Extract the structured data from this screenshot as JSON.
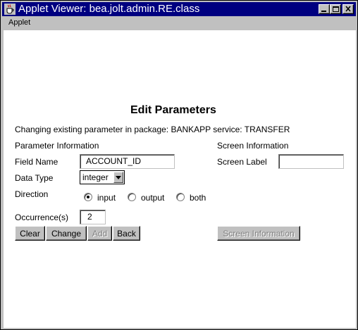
{
  "window": {
    "title": "Applet Viewer: bea.jolt.admin.RE.class",
    "colors": {
      "titlebar": "#000080",
      "face": "#c0c0c0"
    }
  },
  "menu": {
    "items": [
      "Applet"
    ]
  },
  "form": {
    "heading": "Edit Parameters",
    "subtitle": "Changing existing parameter in package: BANKAPP service: TRANSFER",
    "param_info_label": "Parameter Information",
    "screen_info_label": "Screen Information",
    "field_name_label": "Field Name",
    "field_name_value": "ACCOUNT_ID",
    "screen_label_label": "Screen Label",
    "screen_label_value": "",
    "data_type_label": "Data Type",
    "data_type_value": "integer",
    "direction_label": "Direction",
    "direction_options": [
      "input",
      "output",
      "both"
    ],
    "direction_selected": "input",
    "occurrence_label": "Occurrence(s)",
    "occurrence_value": "2"
  },
  "buttons": {
    "clear": "Clear",
    "change": "Change",
    "add": "Add",
    "back": "Back",
    "screen_information": "Screen Information"
  }
}
